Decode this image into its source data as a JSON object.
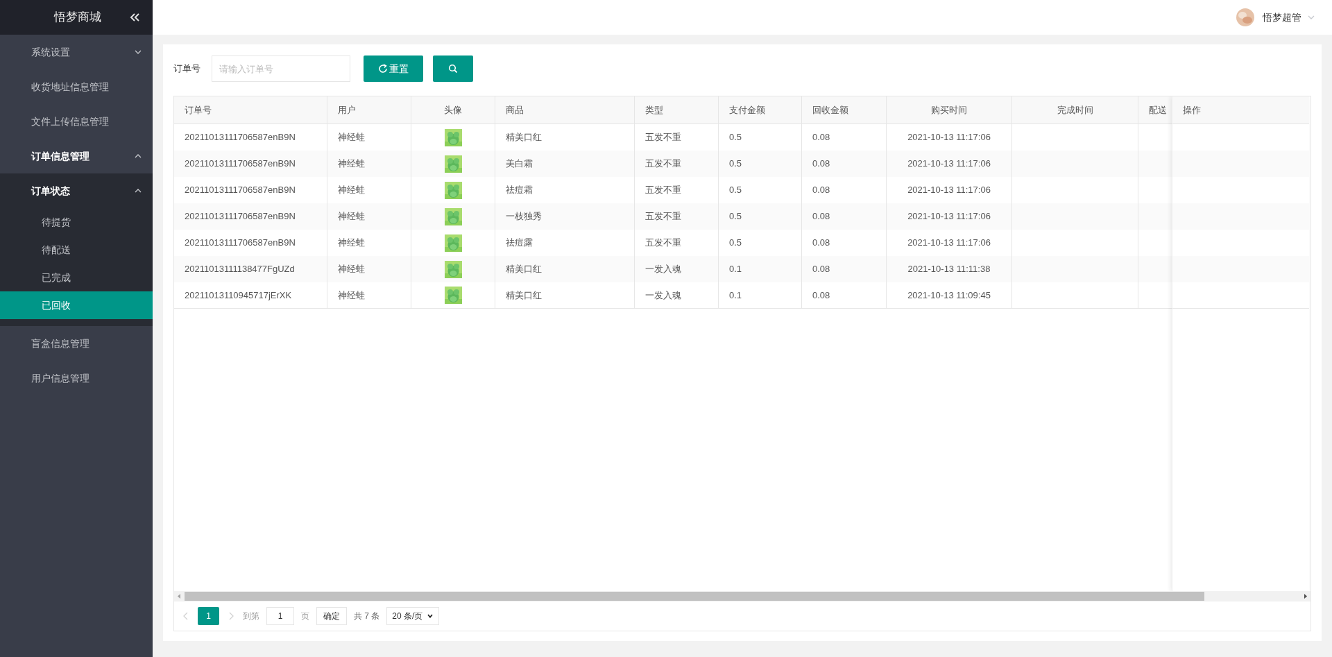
{
  "sidebar": {
    "title": "悟梦商城",
    "items": [
      {
        "label": "系统设置",
        "expanded": false
      },
      {
        "label": "收货地址信息管理",
        "selected": false
      },
      {
        "label": "文件上传信息管理",
        "selected": false
      },
      {
        "label": "订单信息管理",
        "expanded": true,
        "children": [
          {
            "label": "订单状态",
            "expanded": true,
            "children": [
              {
                "label": "待提货",
                "selected": false
              },
              {
                "label": "待配送",
                "selected": false
              },
              {
                "label": "已完成",
                "selected": false
              },
              {
                "label": "已回收",
                "selected": true
              }
            ]
          }
        ]
      },
      {
        "label": "盲盒信息管理",
        "selected": false
      },
      {
        "label": "用户信息管理",
        "selected": false
      }
    ]
  },
  "header": {
    "user": "悟梦超管"
  },
  "search": {
    "label": "订单号",
    "placeholder": "请输入订单号",
    "reset": "重置"
  },
  "table": {
    "columns": [
      "订单号",
      "用户",
      "头像",
      "商品",
      "类型",
      "支付金额",
      "回收金额",
      "购买时间",
      "完成时间",
      "配送"
    ],
    "action_column": "操作",
    "rows": [
      {
        "order": "20211013111706587enB9N",
        "user": "神经蛙",
        "product": "精美口红",
        "type": "五发不重",
        "paid": "0.5",
        "recycled": "0.08",
        "bought": "2021-10-13 11:17:06"
      },
      {
        "order": "20211013111706587enB9N",
        "user": "神经蛙",
        "product": "美白霜",
        "type": "五发不重",
        "paid": "0.5",
        "recycled": "0.08",
        "bought": "2021-10-13 11:17:06"
      },
      {
        "order": "20211013111706587enB9N",
        "user": "神经蛙",
        "product": "祛痘霜",
        "type": "五发不重",
        "paid": "0.5",
        "recycled": "0.08",
        "bought": "2021-10-13 11:17:06"
      },
      {
        "order": "20211013111706587enB9N",
        "user": "神经蛙",
        "product": "一枝独秀",
        "type": "五发不重",
        "paid": "0.5",
        "recycled": "0.08",
        "bought": "2021-10-13 11:17:06"
      },
      {
        "order": "20211013111706587enB9N",
        "user": "神经蛙",
        "product": "祛痘露",
        "type": "五发不重",
        "paid": "0.5",
        "recycled": "0.08",
        "bought": "2021-10-13 11:17:06"
      },
      {
        "order": "20211013111138477FgUZd",
        "user": "神经蛙",
        "product": "精美口红",
        "type": "一发入魂",
        "paid": "0.1",
        "recycled": "0.08",
        "bought": "2021-10-13 11:11:38"
      },
      {
        "order": "20211013110945717jErXK",
        "user": "神经蛙",
        "product": "精美口红",
        "type": "一发入魂",
        "paid": "0.1",
        "recycled": "0.08",
        "bought": "2021-10-13 11:09:45"
      }
    ]
  },
  "pagination": {
    "pages": [
      {
        "label": "1",
        "selected": true
      }
    ],
    "goto_label": "到第",
    "goto_value": "1",
    "page_unit": "页",
    "confirm": "确定",
    "total": "共 7 条",
    "page_size": "20 条/页"
  }
}
